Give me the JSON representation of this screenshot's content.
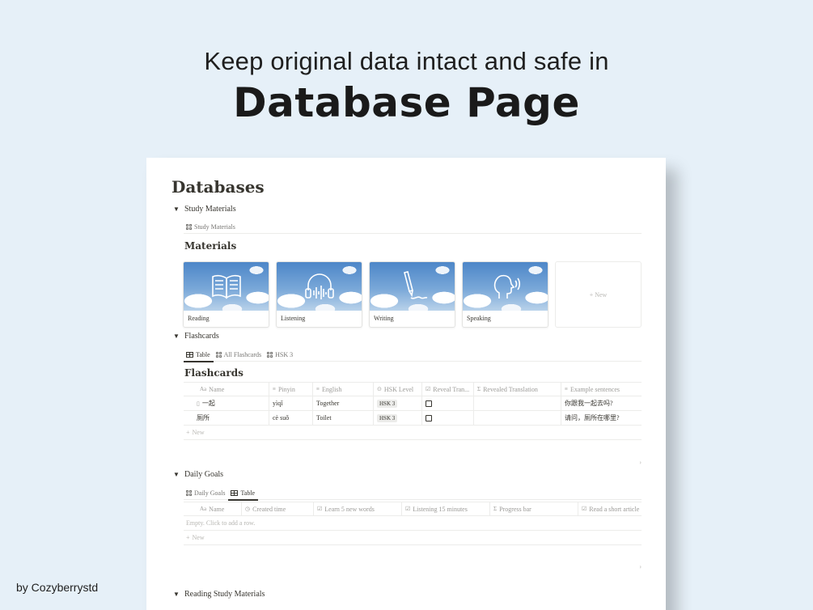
{
  "hero": {
    "subtitle": "Keep original data intact and safe in",
    "title": "Database Page",
    "credit": "by Cozyberrystd"
  },
  "page": {
    "title": "Databases",
    "study_materials": {
      "toggle_label": "Study Materials",
      "view_tab": "Study Materials",
      "heading": "Materials",
      "cards": [
        {
          "label": "Reading",
          "icon": "book-icon"
        },
        {
          "label": "Listening",
          "icon": "headphones-icon"
        },
        {
          "label": "Writing",
          "icon": "pen-icon"
        },
        {
          "label": "Speaking",
          "icon": "speaking-head-icon"
        }
      ],
      "new_label": "+ New"
    },
    "flashcards": {
      "toggle_label": "Flashcards",
      "tabs": [
        "Table",
        "All Flashcards",
        "HSK 3"
      ],
      "heading": "Flashcards",
      "columns": [
        "Name",
        "Pinyin",
        "English",
        "HSK Level",
        "Reveal Tran...",
        "Revealed Translation",
        "Example sentences"
      ],
      "name_prefix": "Aa",
      "rows": [
        {
          "name": "一起",
          "pinyin": "yìqǐ",
          "english": "Together",
          "hsk": "HSK 3",
          "revealed": "",
          "example": "你跟我一起去吗?"
        },
        {
          "name": "厕所",
          "pinyin": "cè suǒ",
          "english": "Toilet",
          "hsk": "HSK 3",
          "revealed": "",
          "example": "请问，厕所在哪里?"
        }
      ],
      "new_label": "New"
    },
    "daily_goals": {
      "toggle_label": "Daily Goals",
      "tabs": [
        "Daily Goals",
        "Table"
      ],
      "columns": [
        "Name",
        "Created time",
        "Learn 5 new words",
        "Listening 15 minutes",
        "Progress bar",
        "Read a short article"
      ],
      "empty_text": "Empty. Click to add a row.",
      "new_label": "New"
    },
    "reading": {
      "toggle_label": "Reading Study Materials"
    }
  }
}
